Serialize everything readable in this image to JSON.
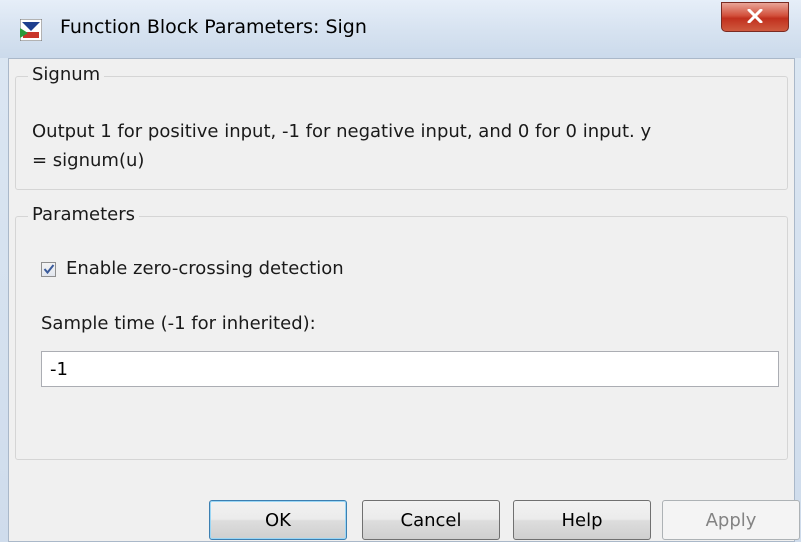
{
  "window": {
    "title": "Function Block Parameters: Sign",
    "icon": "simulink-block-icon",
    "close_icon": "close-icon"
  },
  "signum_group": {
    "label": "Signum",
    "description_line1": "Output 1 for positive input, -1 for negative input, and 0 for 0 input.  y",
    "description_line2": "= signum(u)"
  },
  "parameters_group": {
    "label": "Parameters",
    "zero_crossing": {
      "label": "Enable zero-crossing detection",
      "checked": true
    },
    "sample_time": {
      "label": "Sample time (-1 for inherited):",
      "value": "-1"
    }
  },
  "buttons": {
    "ok": "OK",
    "cancel": "Cancel",
    "help": "Help",
    "apply": "Apply"
  },
  "colors": {
    "close_button": "#c7402b",
    "default_button_border": "#3c7fb1",
    "dialog_background": "#f0f0f0"
  }
}
